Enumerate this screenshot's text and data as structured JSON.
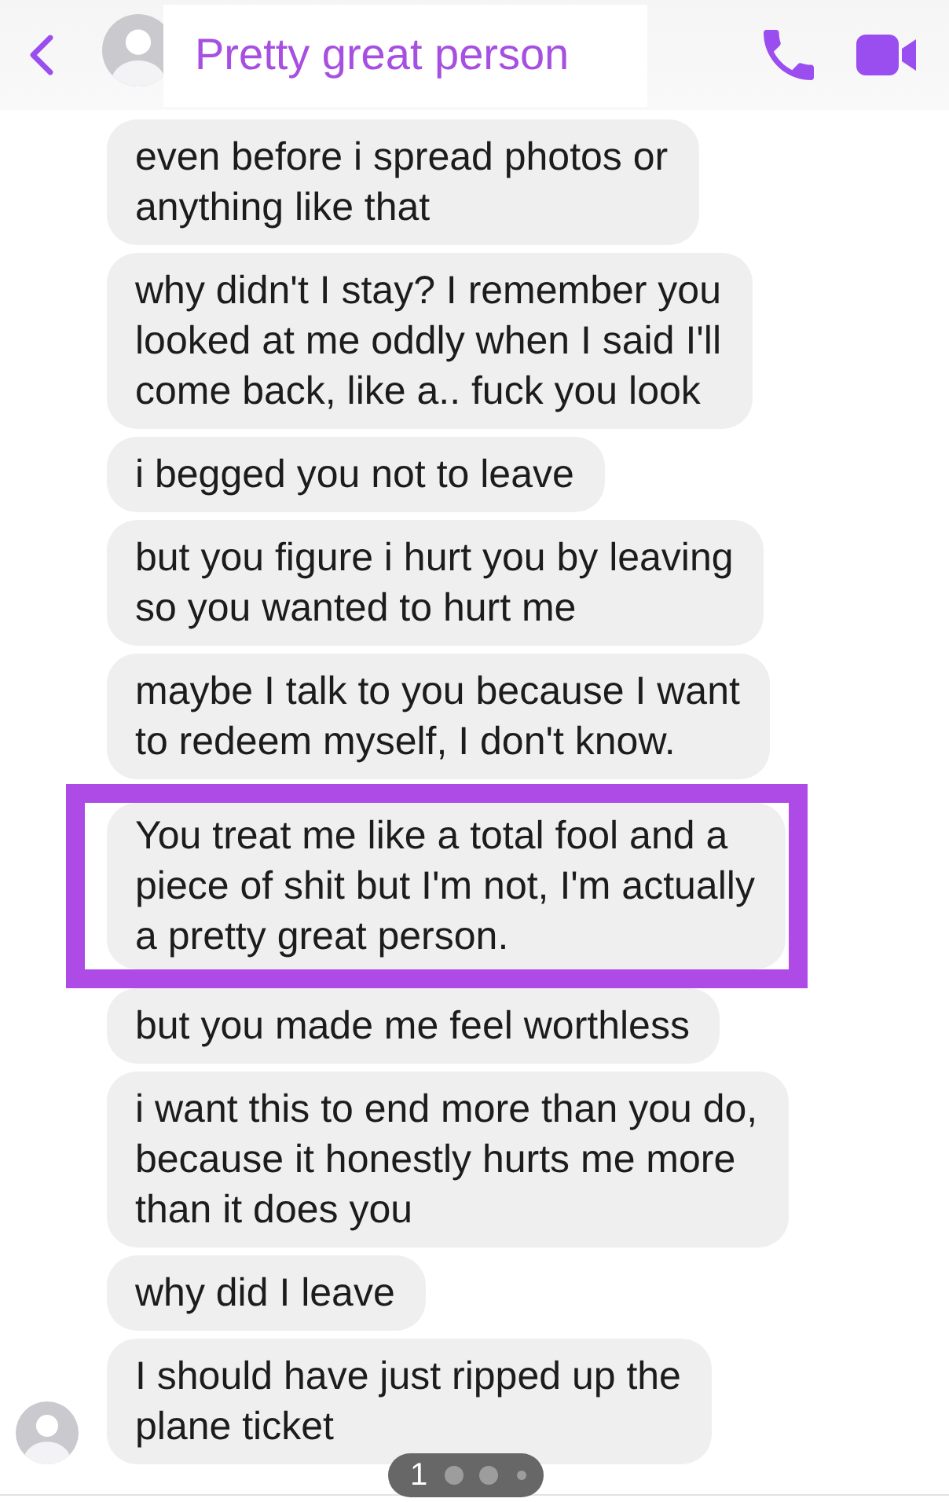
{
  "header": {
    "title": "Pretty great person"
  },
  "messages": [
    {
      "text": "even before i spread photos or anything like that",
      "highlighted": false,
      "show_avatar": false
    },
    {
      "text": "why didn't I stay? I remember you looked at me oddly when I said I'll come back, like a.. fuck you look",
      "highlighted": false,
      "show_avatar": false
    },
    {
      "text": "i begged you not to leave",
      "highlighted": false,
      "show_avatar": false
    },
    {
      "text": "but you figure i hurt you by leaving so you wanted to hurt me",
      "highlighted": false,
      "show_avatar": false
    },
    {
      "text": "maybe I talk to you because I want to redeem myself, I don't know.",
      "highlighted": false,
      "show_avatar": false
    },
    {
      "text": "You treat me like a total fool and a piece of shit but I'm not, I'm actually a pretty great person.",
      "highlighted": true,
      "show_avatar": false
    },
    {
      "text": "but you made me feel worthless",
      "highlighted": false,
      "show_avatar": false
    },
    {
      "text": "i want this to end more than you do, because it honestly hurts me more than it does you",
      "highlighted": false,
      "show_avatar": false
    },
    {
      "text": "why did I leave",
      "highlighted": false,
      "show_avatar": false
    },
    {
      "text": "I should have just ripped up the plane ticket",
      "highlighted": false,
      "show_avatar": true
    }
  ],
  "page_indicator": {
    "label": "1"
  }
}
